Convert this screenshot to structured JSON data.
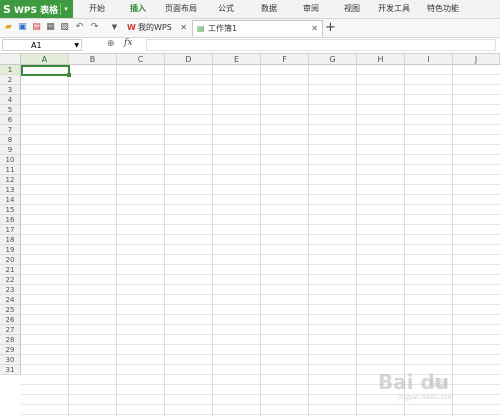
{
  "app": {
    "title": "WPS 表格",
    "logo": "S"
  },
  "menu": [
    "开始",
    "插入",
    "页面布局",
    "公式",
    "数据",
    "审阅",
    "视图",
    "开发工具",
    "特色功能"
  ],
  "active_menu": "插入",
  "toolbar_icons": [
    "open-folder-icon",
    "save-icon",
    "export-pdf-icon",
    "print-icon",
    "print-preview-icon",
    "undo-icon",
    "redo-icon",
    "dropdown-icon"
  ],
  "tabs": [
    {
      "label": "我的WPS",
      "icon": "wps-icon",
      "active": false
    },
    {
      "label": "工作簿1",
      "icon": "spreadsheet-icon",
      "active": true
    }
  ],
  "new_tab_label": "+",
  "formula_bar": {
    "name_box": "A1",
    "fx_label": "fx",
    "value": ""
  },
  "columns": [
    "A",
    "B",
    "C",
    "D",
    "E",
    "F",
    "G",
    "H",
    "I",
    "J"
  ],
  "rows": [
    "1",
    "2",
    "3",
    "4",
    "5",
    "6",
    "7",
    "8",
    "9",
    "10",
    "11",
    "12",
    "13",
    "14",
    "15",
    "16",
    "17",
    "18",
    "19",
    "20",
    "21",
    "22",
    "23",
    "24",
    "25",
    "26",
    "27",
    "28",
    "29",
    "30",
    "31"
  ],
  "selected_cell": "A1",
  "watermark": {
    "main": "Bai du",
    "sub": "经验",
    "url": "jingyan.baidu.com"
  },
  "colors": {
    "accent": "#3e9a3e",
    "selection": "#3a8a3a"
  }
}
